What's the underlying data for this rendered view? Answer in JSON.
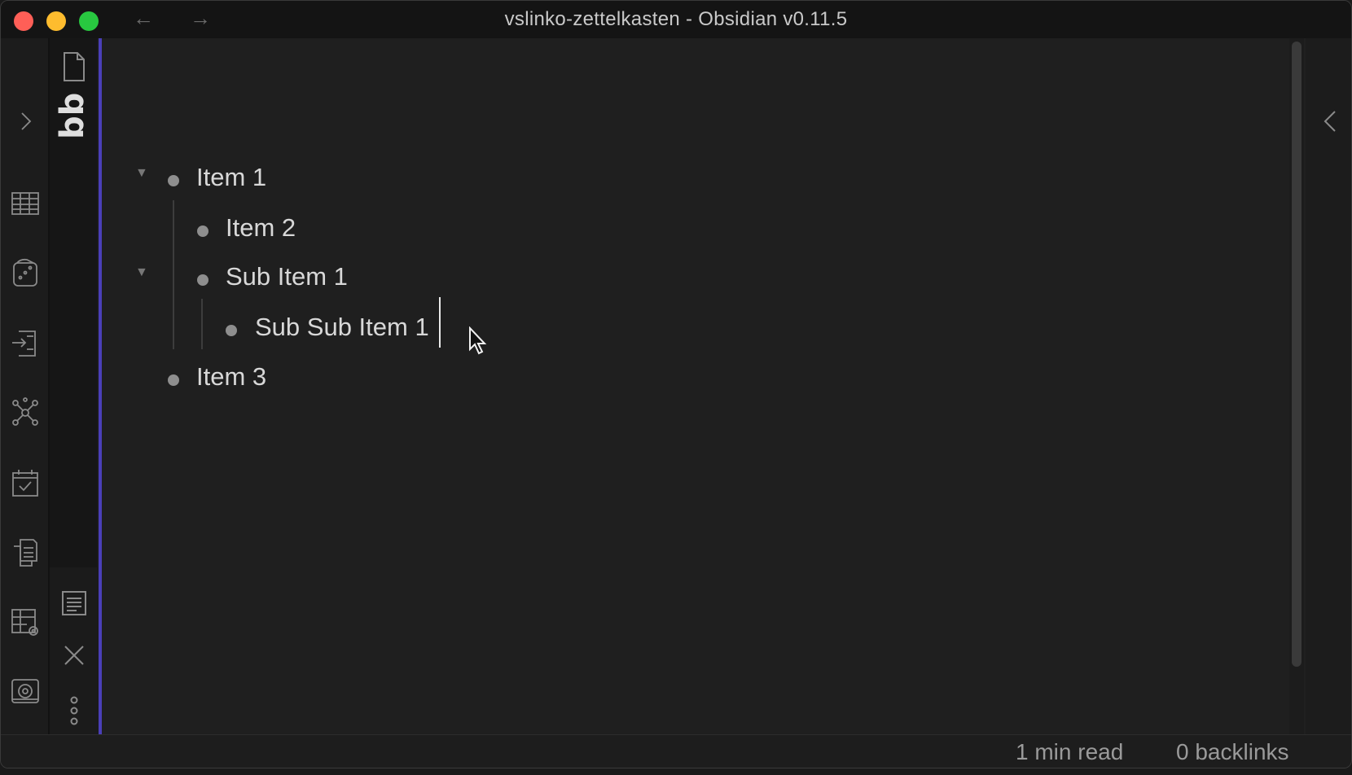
{
  "window": {
    "title": "vslinko-zettelkasten - Obsidian v0.11.5",
    "back_arrow": "←",
    "forward_arrow": "→"
  },
  "ribbon": {
    "icons": [
      "chevron-right-icon",
      "table-icon",
      "dice-icon",
      "import-icon",
      "graph-icon",
      "calendar-check-icon",
      "documents-icon",
      "table-settings-icon",
      "vault-icon"
    ]
  },
  "tabs": {
    "active_tab_label": "bb",
    "icons": [
      "file-icon",
      "outline-icon",
      "close-icon",
      "more-options-icon"
    ]
  },
  "editor": {
    "items": [
      {
        "text": "Item 1",
        "level": 0,
        "foldable": true
      },
      {
        "text": "Item 2",
        "level": 1,
        "foldable": false
      },
      {
        "text": "Sub Item 1",
        "level": 1,
        "foldable": true
      },
      {
        "text": "Sub Sub Item 1",
        "level": 2,
        "foldable": false
      },
      {
        "text": "Item 3",
        "level": 0,
        "foldable": false
      }
    ]
  },
  "status": {
    "read_time": "1 min read",
    "backlinks": "0 backlinks"
  },
  "colors": {
    "accent": "#4a3fb8",
    "background": "#1f1f1f",
    "text": "#d8d8d8"
  }
}
